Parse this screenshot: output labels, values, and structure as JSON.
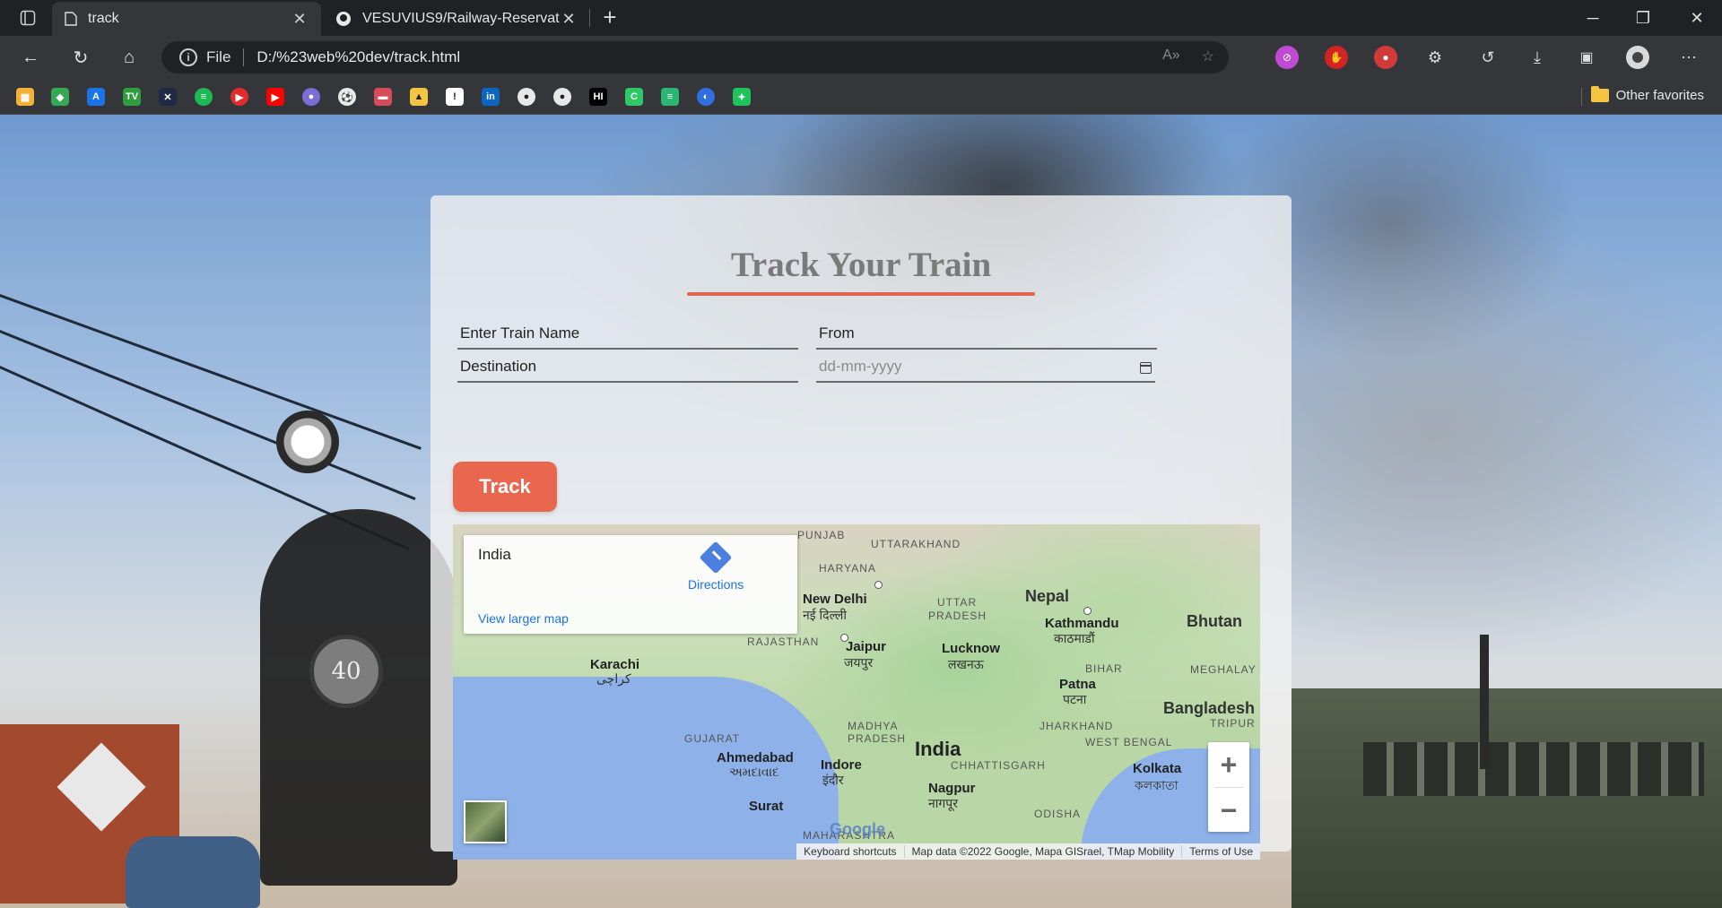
{
  "browser": {
    "tabs": [
      {
        "title": "track",
        "icon": "page-icon"
      },
      {
        "title": "VESUVIUS9/Railway-Reservation",
        "icon": "github-icon"
      }
    ],
    "address": {
      "scheme": "File",
      "url": "D:/%23web%20dev/track.html"
    },
    "bookmarks_other": "Other favorites"
  },
  "page": {
    "title": "Track Your Train",
    "form": {
      "train_name_placeholder": "Enter Train Name",
      "from_placeholder": "From",
      "destination_placeholder": "Destination",
      "date_placeholder": "dd-mm-yyyy",
      "track_button": "Track"
    },
    "map": {
      "place": "India",
      "directions": "Directions",
      "larger_map": "View larger map",
      "labels": {
        "punjab": "PUNJAB",
        "uttarakhand": "UTTARAKHAND",
        "haryana": "HARYANA",
        "new_delhi": "New Delhi",
        "new_delhi_hi": "नई दिल्ली",
        "uttar_pradesh_1": "UTTAR",
        "uttar_pradesh_2": "PRADESH",
        "nepal": "Nepal",
        "kathmandu": "Kathmandu",
        "kathmandu_ne": "काठमाडौं",
        "bhutan": "Bhutan",
        "rajasthan": "RAJASTHAN",
        "jaipur": "Jaipur",
        "jaipur_hi": "जयपुर",
        "lucknow": "Lucknow",
        "lucknow_hi": "लखनऊ",
        "bihar": "BIHAR",
        "meghalaya": "MEGHALAY",
        "karachi": "Karachi",
        "karachi_ur": "کراچی",
        "patna": "Patna",
        "patna_hi": "पटना",
        "bangladesh": "Bangladesh",
        "tripura": "TRIPUR",
        "gujarat": "GUJARAT",
        "madhya_1": "MADHYA",
        "madhya_2": "PRADESH",
        "jharkhand": "JHARKHAND",
        "ahmedabad": "Ahmedabad",
        "ahmedabad_gu": "અમદાવાદ",
        "india": "India",
        "west_bengal": "WEST BENGAL",
        "indore": "Indore",
        "indore_hi": "इंदौर",
        "chhattisgarh": "CHHATTISGARH",
        "kolkata": "Kolkata",
        "kolkata_bn": "কলকাতা",
        "nagpur": "Nagpur",
        "nagpur_hi": "नागपूर",
        "surat": "Surat",
        "odisha": "ODISHA",
        "maharashtra": "MAHARASHTRA"
      },
      "zoom_in": "+",
      "zoom_out": "−",
      "google": "Google",
      "keyboard_shortcuts": "Keyboard shortcuts",
      "map_data": "Map data ©2022 Google, Mapa GISrael, TMap Mobility",
      "terms": "Terms of Use"
    }
  },
  "colors": {
    "accent": "#e9674f",
    "title": "#7a7a7a",
    "link": "#1a73e8"
  }
}
